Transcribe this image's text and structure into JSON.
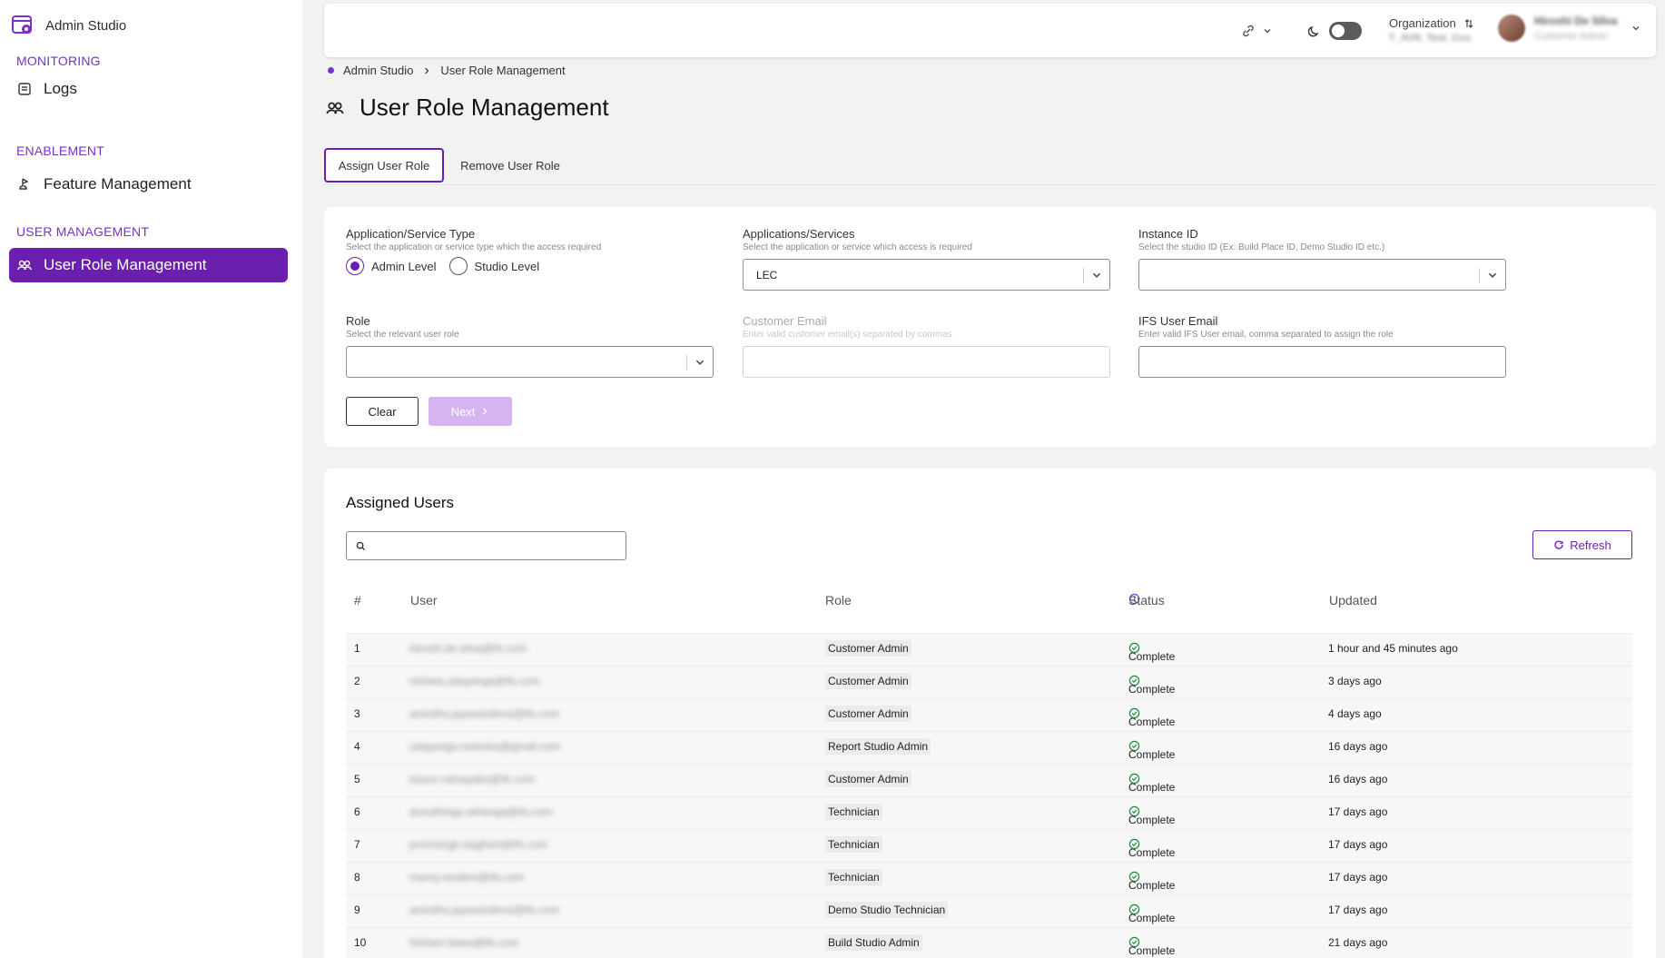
{
  "sidebar": {
    "brand": "Admin Studio",
    "sections": [
      {
        "title": "MONITORING",
        "items": [
          {
            "label": "Logs",
            "icon": "logs-icon"
          }
        ]
      },
      {
        "title": "ENABLEMENT",
        "items": [
          {
            "label": "Feature Management",
            "icon": "feature-icon"
          }
        ]
      },
      {
        "title": "USER MANAGEMENT",
        "items": [
          {
            "label": "User Role Management",
            "icon": "users-icon",
            "active": true
          }
        ]
      }
    ]
  },
  "topbar": {
    "org_label": "Organization",
    "org_value": "T_AVN_Test_Cus",
    "user_name": "Hiroshi De Silva",
    "user_role": "Customer Admin"
  },
  "breadcrumb": [
    "Admin Studio",
    "User Role Management"
  ],
  "page": {
    "title": "User Role Management"
  },
  "tabs": [
    {
      "label": "Assign User Role",
      "active": true
    },
    {
      "label": "Remove User Role",
      "active": false
    }
  ],
  "form": {
    "app_type": {
      "label": "Application/Service Type",
      "hint": "Select the application or service type which the access required",
      "options": [
        "Admin Level",
        "Studio Level"
      ],
      "selected": "Admin Level"
    },
    "app_services": {
      "label": "Applications/Services",
      "hint": "Select the application or service which access is required",
      "value": "LEC"
    },
    "instance_id": {
      "label": "Instance ID",
      "hint": "Select the studio ID (Ex: Build Place ID, Demo Studio ID etc.)",
      "value": ""
    },
    "role": {
      "label": "Role",
      "hint": "Select the relevant user role",
      "value": ""
    },
    "customer_email": {
      "label": "Customer Email",
      "hint": "Enter valid customer email(s) separated by commas",
      "value": ""
    },
    "ifs_email": {
      "label": "IFS User Email",
      "hint": "Enter valid IFS User email, comma separated to assign the role",
      "value": ""
    },
    "clear_label": "Clear",
    "next_label": "Next"
  },
  "assigned": {
    "title": "Assigned Users",
    "search_placeholder": "",
    "refresh_label": "Refresh",
    "columns": [
      "#",
      "User",
      "Role",
      "Status",
      "Updated"
    ],
    "rows": [
      {
        "n": "1",
        "user": "hiroshi.de.silva@ifs.com",
        "role": "Customer Admin",
        "status": "Complete",
        "updated": "1 hour and 45 minutes ago"
      },
      {
        "n": "2",
        "user": "nishwa.udayanga@ifs.com",
        "role": "Customer Admin",
        "status": "Complete",
        "updated": "3 days ago"
      },
      {
        "n": "3",
        "user": "amedha.jayawardena@ifs.com",
        "role": "Customer Admin",
        "status": "Complete",
        "updated": "4 days ago"
      },
      {
        "n": "4",
        "user": "udayanga.rasindra@gmail.com",
        "role": "Report Studio Admin",
        "status": "Complete",
        "updated": "16 days ago"
      },
      {
        "n": "5",
        "user": "kasun.ratnayake@ifs.com",
        "role": "Customer Admin",
        "status": "Complete",
        "updated": "16 days ago"
      },
      {
        "n": "6",
        "user": "dunuthinga.wihanga@ifs.com",
        "role": "Technician",
        "status": "Complete",
        "updated": "17 days ago"
      },
      {
        "n": "7",
        "user": "promsingh.bagheel@ifs.com",
        "role": "Technician",
        "status": "Complete",
        "updated": "17 days ago"
      },
      {
        "n": "8",
        "user": "manoj.randeni@ifs.com",
        "role": "Technician",
        "status": "Complete",
        "updated": "17 days ago"
      },
      {
        "n": "9",
        "user": "amedha.jayawardena@ifs.com",
        "role": "Demo Studio Technician",
        "status": "Complete",
        "updated": "17 days ago"
      },
      {
        "n": "10",
        "user": "hisham.bawa@ifs.com",
        "role": "Build Studio Admin",
        "status": "Complete",
        "updated": "21 days ago"
      }
    ]
  },
  "colors": {
    "accent": "#6a1fae",
    "section": "#7a2fd0",
    "success": "#1f8a3a",
    "next_disabled": "#d6b4f0"
  }
}
